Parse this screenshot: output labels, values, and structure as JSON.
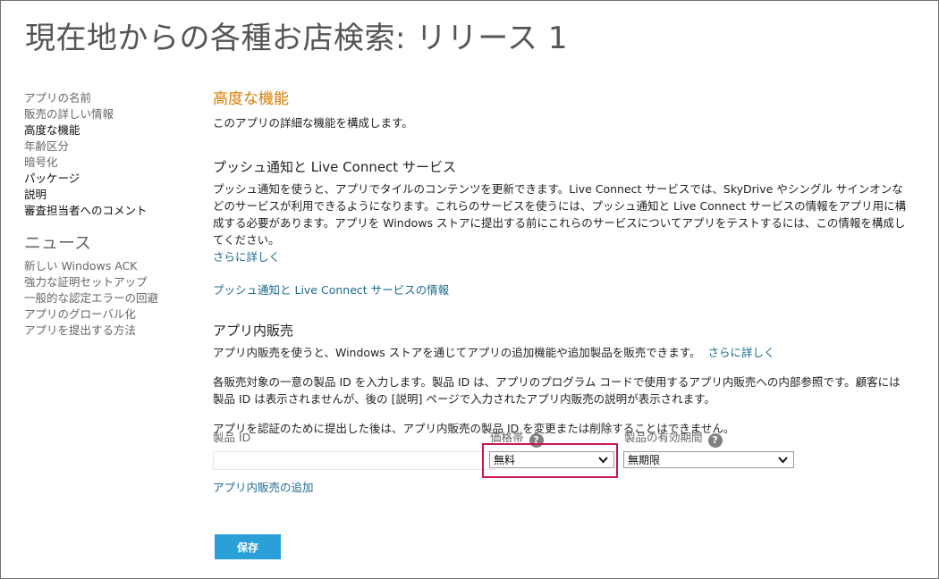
{
  "page": {
    "title": "現在地からの各種お店検索: リリース 1"
  },
  "sidebar": {
    "items": [
      {
        "label": "アプリの名前"
      },
      {
        "label": "販売の詳しい情報"
      },
      {
        "label": "高度な機能"
      },
      {
        "label": "年齢区分"
      },
      {
        "label": "暗号化"
      },
      {
        "label": "パッケージ"
      },
      {
        "label": "説明"
      },
      {
        "label": "審査担当者へのコメント"
      }
    ],
    "news_heading": "ニュース",
    "news": [
      {
        "label": "新しい Windows ACK"
      },
      {
        "label": "強力な証明セットアップ"
      },
      {
        "label": "一般的な認定エラーの回避"
      },
      {
        "label": "アプリのグローバル化"
      },
      {
        "label": "アプリを提出する方法"
      }
    ]
  },
  "main": {
    "section_title": "高度な機能",
    "intro": "このアプリの詳細な機能を構成します。",
    "push": {
      "heading": "プッシュ通知と Live Connect サービス",
      "body": "プッシュ通知を使うと、アプリでタイルのコンテンツを更新できます。Live Connect サービスでは、SkyDrive やシングル サインオンなどのサービスが利用できるようになります。これらのサービスを使うには、プッシュ通知と Live Connect サービスの情報をアプリ用に構成する必要があります。アプリを Windows ストアに提出する前にこれらのサービスについてアプリをテストするには、この情報を構成してください。",
      "learn_more": "さらに詳しく",
      "info_link": "プッシュ通知と Live Connect サービスの情報"
    },
    "iap": {
      "heading": "アプリ内販売",
      "body": "アプリ内販売を使うと、Windows ストアを通じてアプリの追加機能や追加製品を販売できます。",
      "learn_more": "さらに詳しく",
      "body2": "各販売対象の一意の製品 ID を入力します。製品 ID は、アプリのプログラム コードで使用するアプリ内販売への内部参照です。顧客には製品 ID は表示されませんが、後の [説明] ページで入力されたアプリ内販売の説明が表示されます。",
      "body3": "アプリを認証のために提出した後は、アプリ内販売の製品 ID を変更または削除することはできません。",
      "product_id_label": "製品 ID",
      "product_id_value": "",
      "price_label": "価格帯",
      "price_value": "無料",
      "expiry_label": "製品の有効期間",
      "expiry_value": "無期限",
      "help_glyph": "?",
      "add_link": "アプリ内販売の追加"
    },
    "save_label": "保存"
  },
  "colors": {
    "accent_orange": "#d97b00",
    "link": "#1c6a8f",
    "save_button": "#2a9fd8",
    "highlight": "#c8174a"
  },
  "icons": {
    "help": "question-circle-icon",
    "dropdown": "chevron-down-icon"
  }
}
